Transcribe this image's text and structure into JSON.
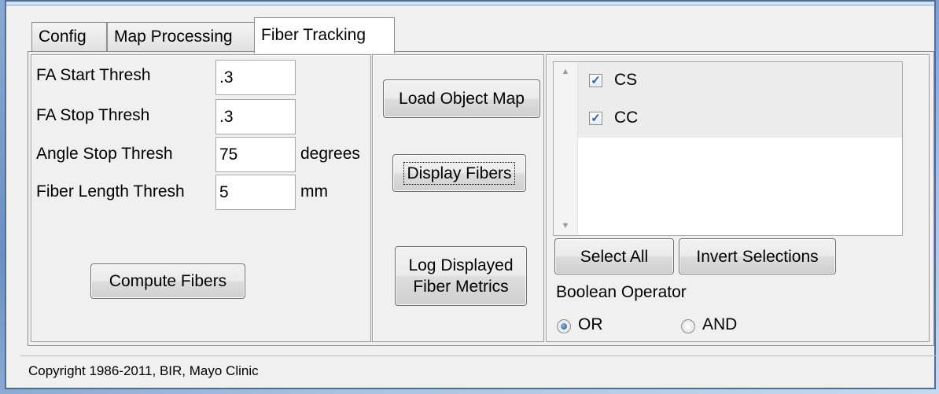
{
  "tabs": [
    {
      "label": "Config"
    },
    {
      "label": "Map Processing"
    },
    {
      "label": "Fiber Tracking"
    }
  ],
  "active_tab": "Fiber Tracking",
  "thresholds": [
    {
      "label": "FA Start Thresh",
      "value": ".3",
      "unit": ""
    },
    {
      "label": "FA Stop Thresh",
      "value": ".3",
      "unit": ""
    },
    {
      "label": "Angle Stop Thresh",
      "value": "75",
      "unit": "degrees"
    },
    {
      "label": "Fiber Length Thresh",
      "value": "5",
      "unit": "mm"
    }
  ],
  "buttons": {
    "compute_fibers": "Compute Fibers",
    "load_object_map": "Load Object Map",
    "display_fibers": "Display Fibers",
    "log_metrics_line1": "Log Displayed",
    "log_metrics_line2": "Fiber Metrics",
    "select_all": "Select All",
    "invert_selections": "Invert Selections"
  },
  "objects": [
    {
      "label": "CS",
      "checked": true
    },
    {
      "label": "CC",
      "checked": true
    }
  ],
  "boolean_operator": {
    "label": "Boolean Operator",
    "options": [
      {
        "label": "OR",
        "selected": true
      },
      {
        "label": "AND",
        "selected": false
      }
    ]
  },
  "status_text": "Copyright 1986-2011, BIR, Mayo Clinic"
}
